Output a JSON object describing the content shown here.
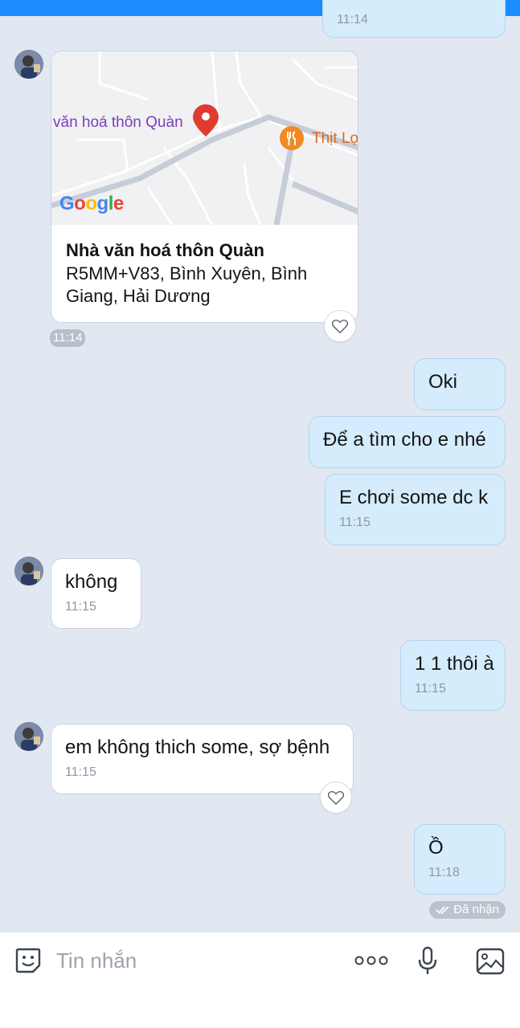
{
  "map_message": {
    "place_label": "văn hoá thôn Quàn",
    "poi_label": "Thịt Lợ",
    "map_brand": "Google",
    "name": "Nhà văn hoá thôn Quàn",
    "address": "R5MM+V83, Bình Xuyên, Bình Giang, Hải Dương",
    "time": "11:14"
  },
  "top_partial_time": "11:14",
  "messages": [
    {
      "side": "out",
      "text": "Oki",
      "time": ""
    },
    {
      "side": "out",
      "text": "Để a tìm cho e nhé",
      "time": ""
    },
    {
      "side": "out",
      "text": "E chơi some dc k",
      "time": "11:15"
    },
    {
      "side": "in",
      "text": "không",
      "time": "11:15"
    },
    {
      "side": "out",
      "text": "1 1 thôi à",
      "time": "11:15"
    },
    {
      "side": "in",
      "text": "em không thich some, sợ bệnh",
      "time": "11:15"
    },
    {
      "side": "out",
      "text": "Ồ",
      "time": "11:18"
    }
  ],
  "status": "Đã nhận",
  "input": {
    "placeholder": "Tin nhắn"
  },
  "colors": {
    "accent": "#1a8cff",
    "out_bubble": "#d4ecfc",
    "background": "#e2e8f1"
  }
}
